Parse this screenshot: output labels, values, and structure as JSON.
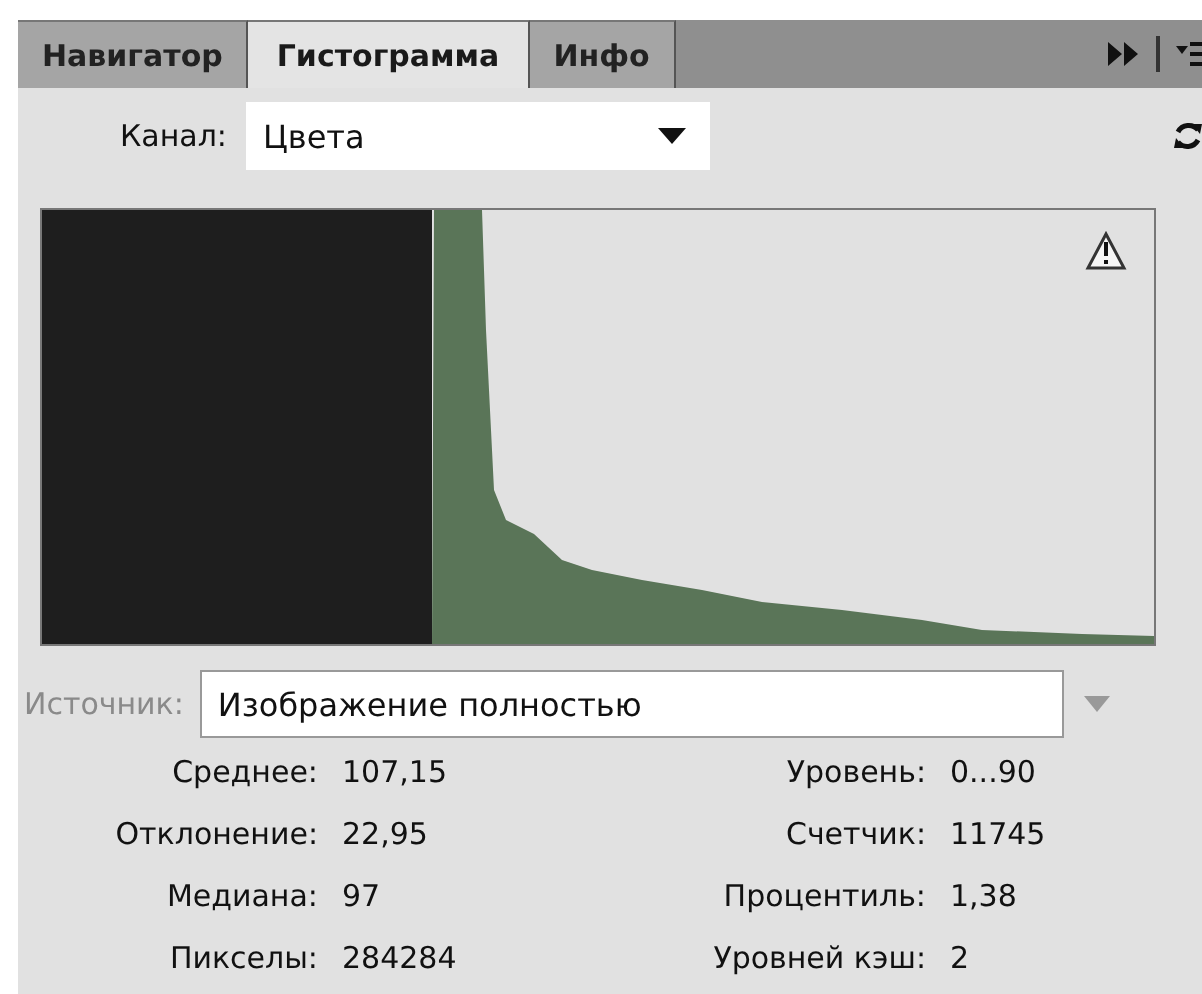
{
  "tabs": [
    {
      "label": "Навигатор",
      "selected": false
    },
    {
      "label": "Гистограмма",
      "selected": true
    },
    {
      "label": "Инфо",
      "selected": false
    }
  ],
  "channel": {
    "label": "Канал:",
    "value": "Цвета"
  },
  "histogram": {
    "warning": true
  },
  "source": {
    "label": "Источник:",
    "value": "Изображение полностью",
    "disabled": true
  },
  "stats": [
    {
      "label": "Среднее:",
      "value": "107,15"
    },
    {
      "label": "Уровень:",
      "value": "0...90"
    },
    {
      "label": "Отклонение:",
      "value": "22,95"
    },
    {
      "label": "Счетчик:",
      "value": "11745"
    },
    {
      "label": "Медиана:",
      "value": "97"
    },
    {
      "label": "Процентиль:",
      "value": "1,38"
    },
    {
      "label": "Пикселы:",
      "value": "284284"
    },
    {
      "label": "Уровней кэш:",
      "value": "2"
    }
  ]
}
